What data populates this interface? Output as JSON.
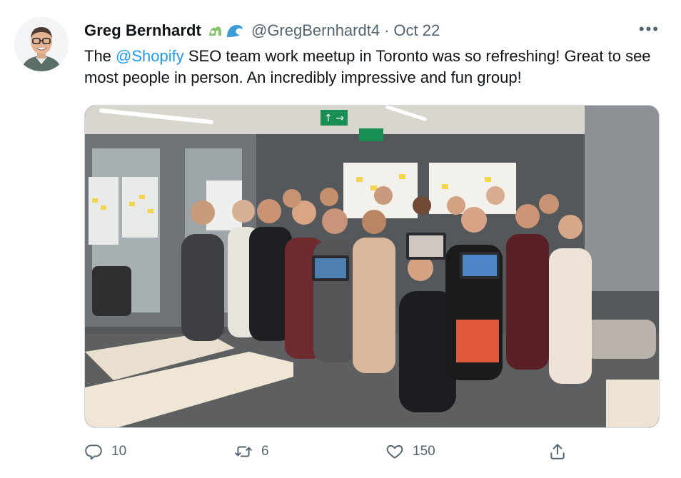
{
  "author": {
    "name": "Greg Bernhardt",
    "handle": "@GregBernhardt4",
    "separator": "·",
    "date": "Oct 22"
  },
  "more_label": "•••",
  "tweet": {
    "prefix": "The ",
    "mention": "@Shopify",
    "suffix": " SEO team work meetup in Toronto was so refreshing! Great to see most people in person. An incredibly impressive and fun group!"
  },
  "photo": {
    "subject": "group photo in an office meeting room",
    "exit_sign_arrow": "→"
  },
  "actions": {
    "reply": {
      "icon": "reply-icon",
      "count": "10"
    },
    "retweet": {
      "icon": "retweet-icon",
      "count": "6"
    },
    "like": {
      "icon": "like-icon",
      "count": "150"
    },
    "share": {
      "icon": "share-icon"
    }
  },
  "colors": {
    "text": "#0f1419",
    "secondary": "#536471",
    "link": "#1d9bf0"
  }
}
